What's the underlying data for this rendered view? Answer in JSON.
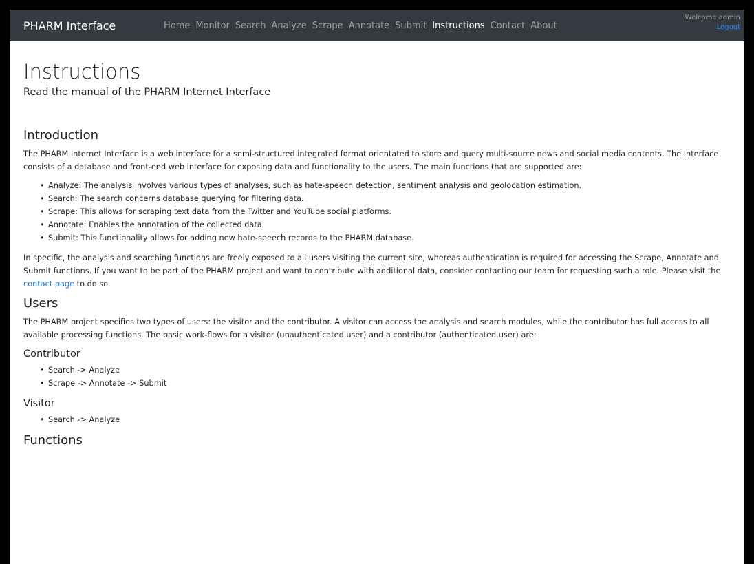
{
  "navbar": {
    "brand": "PHARM Interface",
    "links": [
      "Home",
      "Monitor",
      "Search",
      "Analyze",
      "Scrape",
      "Annotate",
      "Submit",
      "Instructions",
      "Contact",
      "About"
    ],
    "active": "Instructions",
    "welcome": "Welcome admin",
    "logout": "Logout"
  },
  "page": {
    "title": "Instructions",
    "lead": "Read the manual of the PHARM Internet Interface"
  },
  "introduction": {
    "heading": "Introduction",
    "paragraph": "The PHARM Internet Interface is a web interface for a semi-structured integrated format orientated to store and query multi-source news and social media contents. The Interface consists of a database and front-end web interface for exposing data and functionality to the users. The main functions that are supported are:",
    "items": [
      "Analyze: The analysis involves various types of analyses, such as hate-speech detection, sentiment analysis and geolocation estimation.",
      "Search: The search concerns database querying for filtering data.",
      "Scrape: This allows for scraping text data from the Twitter and YouTube social platforms.",
      "Annotate: Enables the annotation of the collected data.",
      "Submit: This functionality allows for adding new hate-speech records to the PHARM database."
    ],
    "paragraph2_before": "In specific, the analysis and searching functions are freely exposed to all users visiting the current site, whereas authentication is required for accessing the Scrape, Annotate and Submit functions. If you want to be part of the PHARM project and want to contribute with additional data, consider contacting our team for requesting such a role. Please visit the ",
    "contact_link": "contact page",
    "paragraph2_after": " to do so."
  },
  "users": {
    "heading": "Users",
    "paragraph": "The PHARM project specifies two types of users: the visitor and the contributor. A visitor can access the analysis and search modules, while the contributor has full access to all available processing functions. The basic work-flows for a visitor (unauthenticated user) and a contributor (authenticated user) are:",
    "contributor": {
      "heading": "Contributor",
      "items": [
        "Search -> Analyze",
        "Scrape -> Annotate -> Submit"
      ]
    },
    "visitor": {
      "heading": "Visitor",
      "items": [
        "Search -> Analyze"
      ]
    }
  },
  "functions": {
    "heading": "Functions"
  }
}
